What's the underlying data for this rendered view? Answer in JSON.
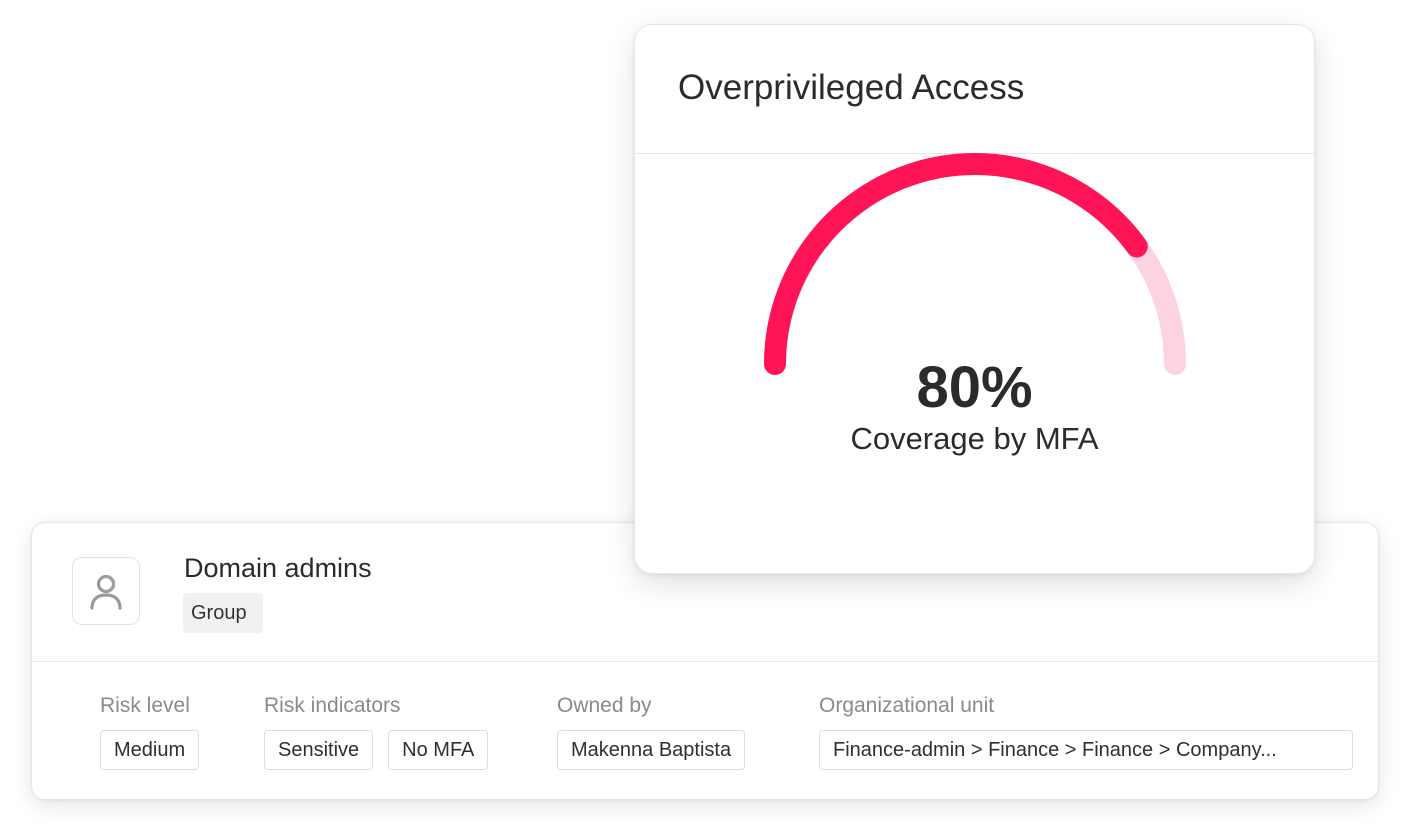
{
  "overprivileged_card": {
    "title": "Overprivileged Access",
    "value": "80%",
    "caption": "Coverage by MFA",
    "progress_fraction": 0.8,
    "colors": {
      "filled": "#ff1458",
      "track": "#fcd3df"
    }
  },
  "entity_card": {
    "icon": "user-icon",
    "title": "Domain admins",
    "type_tag": "Group",
    "attributes": {
      "risk_level": {
        "label": "Risk level",
        "values": [
          "Medium"
        ]
      },
      "risk_indicators": {
        "label": "Risk indicators",
        "values": [
          "Sensitive",
          "No MFA"
        ]
      },
      "owned_by": {
        "label": "Owned by",
        "values": [
          "Makenna Baptista"
        ]
      },
      "organizational_unit": {
        "label": "Organizational unit",
        "values": [
          "Finance-admin > Finance > Finance > Company..."
        ]
      }
    }
  }
}
